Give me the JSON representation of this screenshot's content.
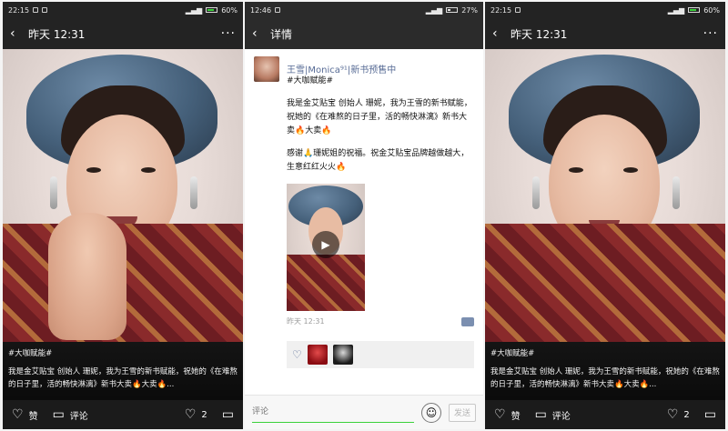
{
  "panels": {
    "left": {
      "status": {
        "time": "22:15",
        "battery": "60%"
      },
      "topbar": {
        "back_icon": "‹",
        "title": "昨天 12:31",
        "more_icon": "···"
      },
      "caption": {
        "tag": "#大咖赋能#",
        "text": "我是金艾贴宝 创始人 珊妮，我为王雪的新书赋能，祝她的《在难熬的日子里，活的畅快淋漓》新书大卖🔥大卖🔥..."
      },
      "bottombar": {
        "like_label": "赞",
        "comment_label": "评论",
        "like_count": "2"
      }
    },
    "middle": {
      "status": {
        "time": "12:46",
        "battery": "27%"
      },
      "topbar": {
        "back_icon": "‹",
        "title": "详情"
      },
      "author": {
        "name": "王雪|Monica⁹¹|新书预售中"
      },
      "post": {
        "tag": "#大咖赋能#",
        "para1": "我是金艾贴宝 创始人 珊妮，我为王雪的新书赋能，祝她的《在难熬的日子里，活的畅快淋漓》新书大卖🔥大卖🔥",
        "para2": "感谢🙏珊妮姐的祝福。祝金艾贴宝品牌越做越大，生意红红火火🔥"
      },
      "meta": {
        "time": "昨天 12:31"
      },
      "composer": {
        "placeholder": "评论",
        "send_label": "发送",
        "emoji_icon": "☺"
      }
    },
    "right": {
      "status": {
        "time": "22:15",
        "battery": "60%"
      },
      "topbar": {
        "back_icon": "‹",
        "title": "昨天 12:31",
        "more_icon": "···"
      },
      "caption": {
        "tag": "#大咖赋能#",
        "text": "我是金艾贴宝 创始人 珊妮，我为王雪的新书赋能，祝她的《在难熬的日子里，活的畅快淋漓》新书大卖🔥大卖🔥..."
      },
      "bottombar": {
        "like_label": "赞",
        "comment_label": "评论",
        "like_count": "2"
      }
    }
  },
  "colors": {
    "link": "#576b95",
    "accent_green": "#3ad13a",
    "dark_bar": "#1b1b1b"
  }
}
